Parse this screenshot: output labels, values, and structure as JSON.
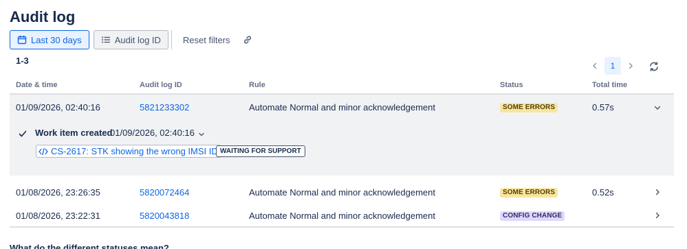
{
  "page": {
    "title": "Audit log"
  },
  "toolbar": {
    "date_filter": "Last 30 days",
    "id_filter": "Audit log ID",
    "reset": "Reset filters",
    "icons": {
      "date": "calendar-icon",
      "id": "list-icon",
      "link": "link-icon"
    }
  },
  "results": {
    "range": "1-3"
  },
  "pagination": {
    "current_page": "1"
  },
  "table": {
    "headers": [
      "Date & time",
      "Audit log ID",
      "Rule",
      "Status",
      "Total time"
    ],
    "rows": [
      {
        "datetime": "01/09/2026, 02:40:16",
        "id": "5821233302",
        "rule": "Automate Normal and minor acknowledgement",
        "status": "SOME ERRORS",
        "total_time": "0.57s",
        "expanded": true,
        "detail": {
          "title": "Work item created",
          "time": "01/09/2026, 02:40:16",
          "work_item": "CS-2617: STK showing the wrong IMSI ID",
          "work_item_status": "WAITING FOR SUPPORT"
        }
      },
      {
        "datetime": "01/08/2026, 23:26:35",
        "id": "5820072464",
        "rule": "Automate Normal and minor acknowledgement",
        "status": "SOME ERRORS",
        "total_time": "0.52s",
        "expanded": false
      },
      {
        "datetime": "01/08/2026, 23:22:31",
        "id": "5820043818",
        "rule": "Automate Normal and minor acknowledgement",
        "status": "CONFIG CHANGE",
        "total_time": "",
        "expanded": false
      }
    ]
  },
  "footer": {
    "question": "What do the different statuses mean?"
  },
  "colors": {
    "accent": "#0c66e4",
    "some_errors_bg": "#f8e6a0",
    "config_change_bg": "#dfd8fd",
    "expanded_row_bg": "#f1f2f4"
  }
}
